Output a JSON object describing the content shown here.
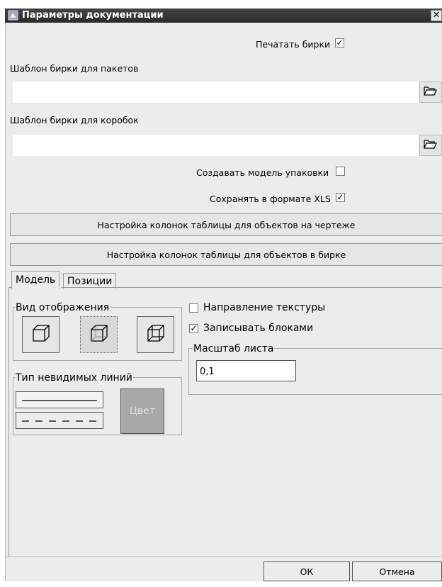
{
  "window": {
    "title": "Параметры документации",
    "close_glyph": "✕"
  },
  "print_tags": {
    "label": "Печатать бирки",
    "checked": true
  },
  "packet_template": {
    "label": "Шаблон бирки для пакетов",
    "value": ""
  },
  "box_template": {
    "label": "Шаблон бирки для коробок",
    "value": ""
  },
  "create_package_model": {
    "label": "Создавать модель упаковки",
    "checked": false
  },
  "save_xls": {
    "label": "Сохранять в формате XLS",
    "checked": true
  },
  "buttons": {
    "columns_drawing": "Настройка колонок таблицы для объектов на чертеже",
    "columns_tag": "Настройка колонок таблицы для объектов в бирке",
    "ok": "ОК",
    "cancel": "Отмена"
  },
  "tabs": [
    {
      "label": "Модель",
      "active": true
    },
    {
      "label": "Позиции",
      "active": false
    }
  ],
  "model_tab": {
    "view_group_title": "Вид отображения",
    "view_buttons": [
      "solid-cube-icon",
      "hidden-lines-cube-icon",
      "wireframe-cube-icon"
    ],
    "hidden_lines_group_title": "Тип невидимых линий",
    "color_button": "Цвет",
    "texture_direction": {
      "label": "Направление текстуры",
      "checked": false
    },
    "write_blocks": {
      "label": "Записывать блоками",
      "checked": true
    },
    "sheet_scale": {
      "label": "Масштаб листа",
      "value": "0,1"
    }
  },
  "check_glyph": "✓",
  "colors": {
    "title_bar": "#333333",
    "dialog_bg": "#ececec",
    "color_button": "#a8a8a8"
  }
}
